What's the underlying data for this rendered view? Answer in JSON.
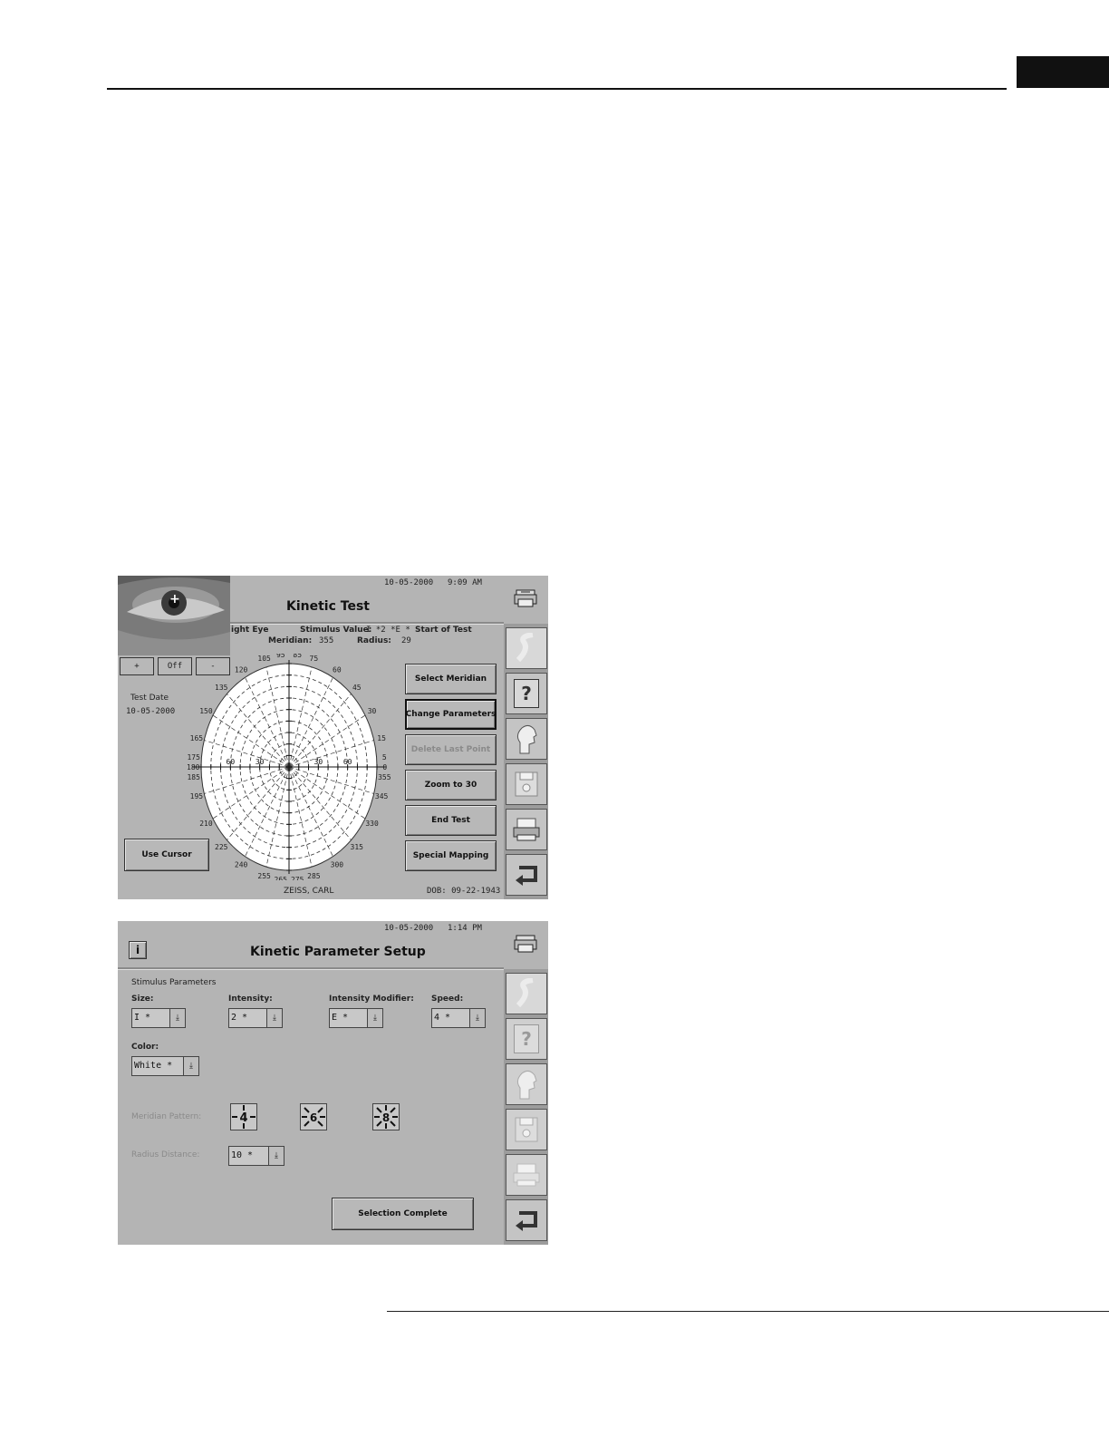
{
  "screen1": {
    "date": "10-05-2000",
    "time": "9:09 AM",
    "title": "Kinetic Test",
    "eye": "Right Eye",
    "eye_visible": "ight Eye",
    "stimulus_label": "Stimulus Value:",
    "stimulus_value": "I *2 *E *",
    "start_label": "Start of Test",
    "meridian_label": "Meridian:",
    "meridian_value": "355",
    "radius_label": "Radius:",
    "radius_value": "29",
    "cam_plus": "+",
    "cam_off": "Off",
    "cam_minus": "-",
    "test_date_label": "Test Date",
    "test_date": "10-05-2000",
    "use_cursor": "Use Cursor",
    "buttons": {
      "select_meridian": "Select Meridian",
      "change_parameters": "Change Parameters",
      "delete_last_point": "Delete Last Point",
      "zoom_to_30": "Zoom to 30",
      "end_test": "End Test",
      "special_mapping": "Special Mapping"
    },
    "patient": "ZEISS, CARL",
    "dob": "DOB: 09-22-1943",
    "meridian_labels": [
      "0",
      "15",
      "30",
      "45",
      "60",
      "75",
      "85",
      "95",
      "105",
      "120",
      "135",
      "150",
      "165",
      "175",
      "180",
      "185",
      "195",
      "210",
      "225",
      "240",
      "255",
      "265",
      "275",
      "285",
      "300",
      "315",
      "330",
      "345",
      "355",
      "5"
    ],
    "scale_labels": {
      "r60": "60",
      "r30": "30"
    },
    "help_glyph": "?"
  },
  "screen2": {
    "date": "10-05-2000",
    "time": "1:14 PM",
    "title": "Kinetic Parameter Setup",
    "info_glyph": "i",
    "stimulus_params": "Stimulus Parameters",
    "size_label": "Size:",
    "size_value": "I *",
    "intensity_label": "Intensity:",
    "intensity_value": "2 *",
    "modifier_label": "Intensity Modifier:",
    "modifier_value": "E *",
    "speed_label": "Speed:",
    "speed_value": "4 *",
    "color_label": "Color:",
    "color_value": "White *",
    "meridian_pattern_label": "Meridian Pattern:",
    "patterns": [
      "4",
      "6",
      "8"
    ],
    "radius_label": "Radius Distance:",
    "radius_value": "10 *",
    "selection_complete": "Selection Complete",
    "help_glyph": "?"
  }
}
